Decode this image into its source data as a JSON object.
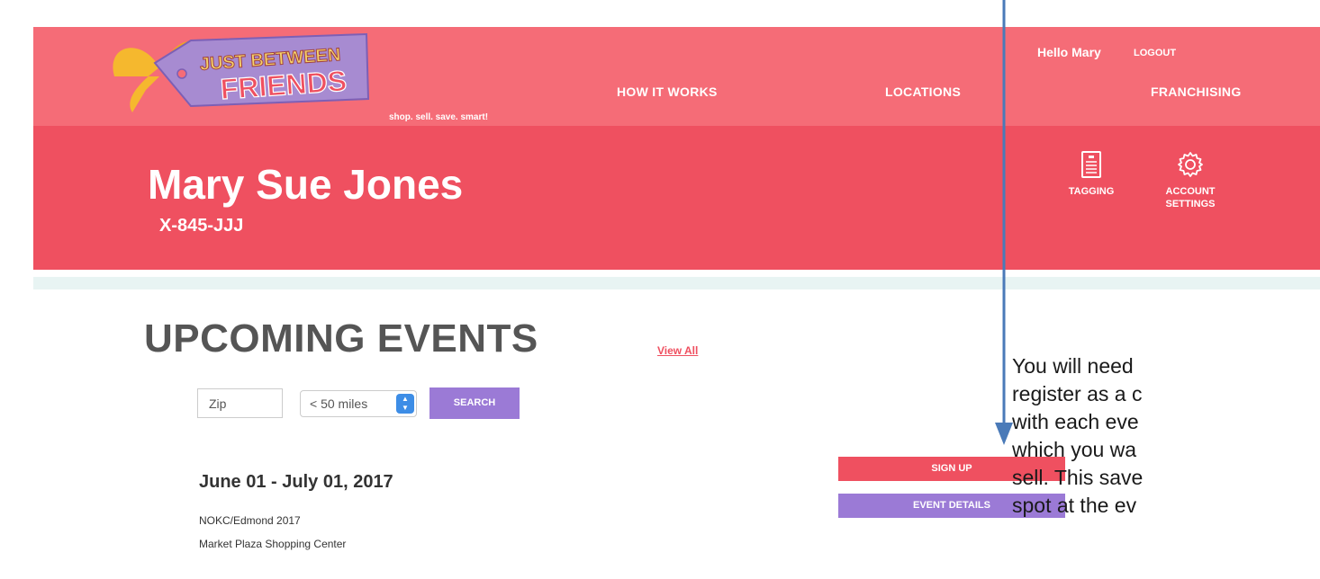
{
  "header": {
    "logo_text_top": "JUST BETWEEN",
    "logo_text_bottom": "FRIENDS",
    "tagline": "shop. sell. save. smart!",
    "nav": [
      {
        "label": "HOW IT WORKS"
      },
      {
        "label": "LOCATIONS"
      },
      {
        "label": "FRANCHISING"
      }
    ],
    "greeting": "Hello Mary",
    "logout_label": "LOGOUT"
  },
  "profile": {
    "name": "Mary Sue Jones",
    "consignor_id": "X-845-JJJ",
    "actions": [
      {
        "label_line1": "TAGGING",
        "label_line2": "",
        "icon": "tag-document-icon"
      },
      {
        "label_line1": "ACCOUNT",
        "label_line2": "SETTINGS",
        "icon": "gear-icon"
      }
    ]
  },
  "events": {
    "title": "UPCOMING EVENTS",
    "view_all_label": "View All",
    "search": {
      "zip_placeholder": "Zip",
      "radius_selected": "< 50 miles",
      "search_label": "SEARCH"
    },
    "items": [
      {
        "date_range": "June 01 - July 01, 2017",
        "name": "NOKC/Edmond 2017",
        "location": "Market Plaza Shopping Center",
        "signup_label": "SIGN UP",
        "details_label": "EVENT DETAILS"
      }
    ]
  },
  "annotation": {
    "lines": [
      "You will need",
      "register as a c",
      "with each eve",
      "which you wa",
      "sell. This save",
      "spot at the ev"
    ],
    "arrow_color": "#4a7ab8"
  },
  "colors": {
    "nav_band": "#f56c77",
    "profile_band": "#ef5060",
    "purple": "#9b7ad6",
    "logo_purple": "#a78bd1",
    "logo_ribbon": "#f5b82e"
  }
}
